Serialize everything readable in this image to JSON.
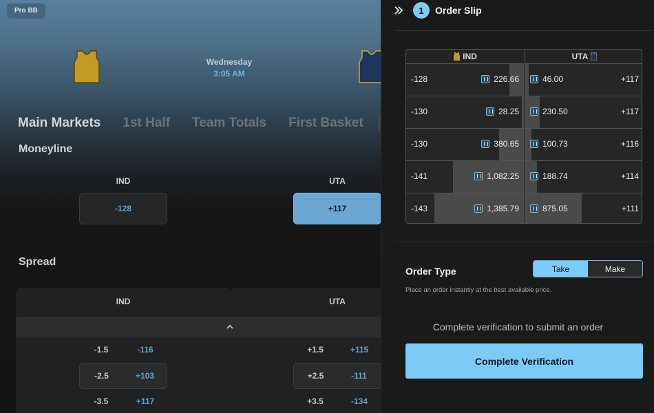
{
  "game": {
    "league": "Pro BB",
    "day": "Wednesday",
    "time": "3:05 AM",
    "home_jersey_color": "#c49a25",
    "away_jersey_color": "#1e3560"
  },
  "tabs": [
    "Main Markets",
    "1st Half",
    "Team Totals",
    "First Basket"
  ],
  "moneyline": {
    "title": "Moneyline",
    "teams": [
      {
        "name": "IND",
        "odds": "-128",
        "selected": false
      },
      {
        "name": "UTA",
        "odds": "+117",
        "selected": true
      }
    ]
  },
  "spread": {
    "title": "Spread",
    "teams": [
      "IND",
      "UTA"
    ],
    "ind_rows": [
      {
        "line": "-1.5",
        "odds": "-116"
      },
      {
        "line": "-2.5",
        "odds": "+103"
      },
      {
        "line": "-3.5",
        "odds": "+117"
      }
    ],
    "uta_rows": [
      {
        "line": "+1.5",
        "odds": "+115"
      },
      {
        "line": "+2.5",
        "odds": "-111"
      },
      {
        "line": "+3.5",
        "odds": "-134"
      }
    ]
  },
  "order_slip": {
    "count": "1",
    "title": "Order Slip",
    "book": {
      "left_team": "IND",
      "right_team": "UTA",
      "rows": [
        {
          "left_odds": "-128",
          "left_amount": "226.66",
          "left_depth": 0.16,
          "right_amount": "46.00",
          "right_odds": "+117",
          "right_depth": 0.04
        },
        {
          "left_odds": "-130",
          "left_amount": "28.25",
          "left_depth": 0.02,
          "right_amount": "230.50",
          "right_odds": "+117",
          "right_depth": 0.16
        },
        {
          "left_odds": "-130",
          "left_amount": "380.65",
          "left_depth": 0.28,
          "right_amount": "100.73",
          "right_odds": "+116",
          "right_depth": 0.07
        },
        {
          "left_odds": "-141",
          "left_amount": "1,082.25",
          "left_depth": 0.79,
          "right_amount": "188.74",
          "right_odds": "+114",
          "right_depth": 0.13
        },
        {
          "left_odds": "-143",
          "left_amount": "1,385.79",
          "left_depth": 1.0,
          "right_amount": "875.05",
          "right_odds": "+111",
          "right_depth": 0.63
        }
      ]
    },
    "order_type": {
      "label": "Order Type",
      "options": [
        "Take",
        "Make"
      ],
      "selected": "Take",
      "help": "Place an order instantly at the best available price."
    },
    "verify_message": "Complete verification to submit an order",
    "verify_button": "Complete Verification"
  },
  "colors": {
    "accent": "#7ccaf7",
    "odds_blue": "#5fa3d3"
  }
}
